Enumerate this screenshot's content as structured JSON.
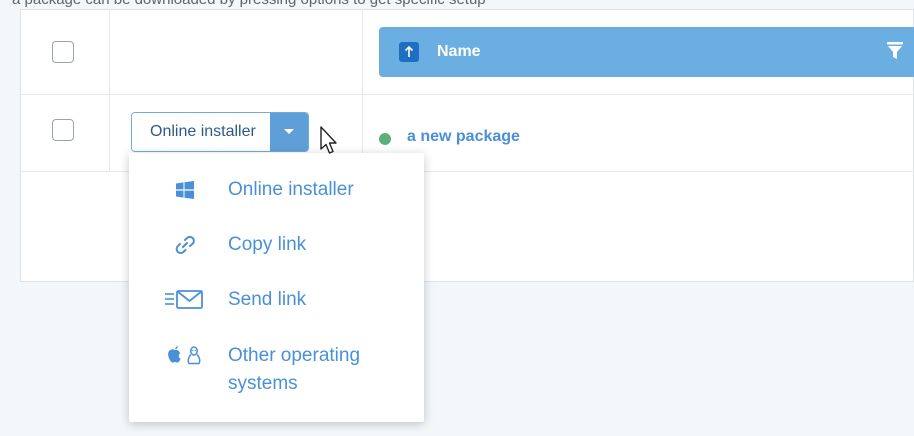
{
  "top_text": "a package can be downloaded by pressing options to get specific setup",
  "table": {
    "header": {
      "name_label": "Name",
      "sort_icon": "arrow-up-icon",
      "filter_icon": "filter-icon"
    },
    "rows": [
      {
        "action_button_label": "Online installer",
        "status_color": "#5bb07a",
        "package_name": "a new package"
      }
    ]
  },
  "dropdown": {
    "items": [
      {
        "label": "Online installer",
        "icon": "windows-icon"
      },
      {
        "label": "Copy link",
        "icon": "link-icon"
      },
      {
        "label": "Send link",
        "icon": "envelope-icon"
      },
      {
        "label": "Other operating systems",
        "icon": "apple-linux-icon",
        "label_line1": "Other operating",
        "label_line2": "systems"
      }
    ]
  },
  "colors": {
    "accent": "#6aaee2",
    "sort_badge": "#1e6fc1",
    "link": "#4a90d6",
    "status_green": "#5bb07a"
  }
}
